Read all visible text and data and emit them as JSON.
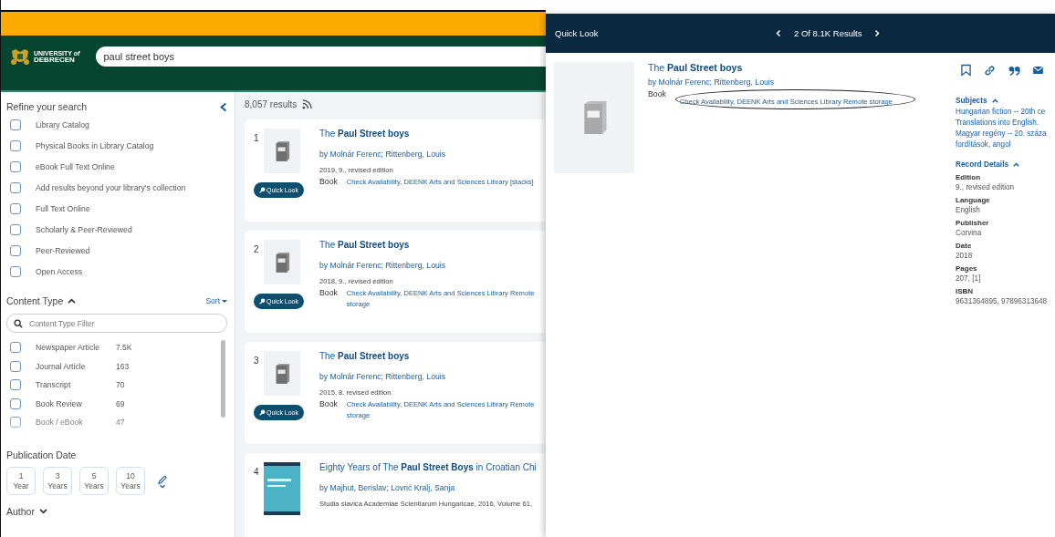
{
  "logo": {
    "line1": "UNIVERSITY *of*",
    "line2": "DEBRECEN"
  },
  "search": {
    "value": "paul street boys"
  },
  "sidebar": {
    "title": "Refine your search",
    "filters": [
      {
        "label": "Library Catalog",
        "checked": false
      },
      {
        "label": "Physical Books in Library Catalog",
        "checked": false
      },
      {
        "label": "eBook Full Text Online",
        "checked": false
      },
      {
        "label": "Add results beyond your library's collection",
        "checked": false
      },
      {
        "label": "Full Text Online",
        "checked": false
      },
      {
        "label": "Scholarly & Peer-Reviewed",
        "checked": false
      },
      {
        "label": "Peer-Reviewed",
        "checked": false
      },
      {
        "label": "Open Access",
        "checked": false
      }
    ],
    "content_type": {
      "title": "Content Type",
      "sort": "Sort",
      "filter_placeholder": "Content Type Filter",
      "expanded": true,
      "items": [
        {
          "label": "Newspaper Article",
          "count": "7.5K",
          "checked": false
        },
        {
          "label": "Journal Article",
          "count": "163",
          "checked": false
        },
        {
          "label": "Transcript",
          "count": "70",
          "checked": false
        },
        {
          "label": "Book Review",
          "count": "69",
          "checked": false
        },
        {
          "label": "Book / eBook",
          "count": "47",
          "checked": false
        }
      ]
    },
    "publication_date": {
      "title": "Publication Date",
      "ranges": [
        {
          "value": "1",
          "unit": "Year"
        },
        {
          "value": "3",
          "unit": "Years"
        },
        {
          "value": "5",
          "unit": "Years"
        },
        {
          "value": "10",
          "unit": "Years"
        }
      ]
    },
    "author": {
      "title": "Author",
      "expanded": false
    }
  },
  "results": {
    "count": "8,057 results",
    "items": [
      {
        "number": "1",
        "title": "The **Paul Street boys**",
        "authors": "by Molnár Ferenc; Rittenberg, Louis",
        "edition": "2019, 9., revised edition",
        "type": "Book",
        "availability": "Check Availability, DEENK Arts and Sciences Library [stacks]",
        "kind": "book",
        "quick_look": "Quick Look"
      },
      {
        "number": "2",
        "title": "The **Paul Street boys**",
        "authors": "by Molnár Ferenc; Rittenberg, Louis",
        "edition": "2018, 9., revised edition",
        "type": "Book",
        "availability": "Check Availability, DEENK Arts and Sciences Library Remote storage",
        "kind": "book",
        "quick_look": "Quick Look"
      },
      {
        "number": "3",
        "title": "The **Paul Street boys**",
        "authors": "by Molnár Ferenc; Rittenberg, Louis",
        "edition": "2015, 8. revised edition",
        "type": "Book",
        "availability": "Check Availability, DEENK Arts and Sciences Library Remote storage",
        "kind": "book",
        "quick_look": "Quick Look"
      },
      {
        "number": "4",
        "title": "Eighty Years of The **Paul Street Boys** in Croatian Chi",
        "authors": "by Majhut, Berislav; Lovrić Kralj, Sanja",
        "edition": "Studia slavica Academiae Scientiarum Hungaricae, 2016, Volume 61,",
        "kind": "article"
      }
    ]
  },
  "quick_look": {
    "title": "Quick Look",
    "position": "2 Of 8.1K Results",
    "record": {
      "title": "The **Paul Street boys**",
      "authors": "by Molnár Ferenc; Rittenberg, Louis",
      "type": "Book",
      "availability": "Check Availability, DEENK Arts and Sciences Library Remote storage"
    },
    "subjects": {
      "title": "Subjects",
      "expanded": true,
      "items": [
        "Hungarian fiction -- 20th ce",
        "Translations into English.",
        "Magyar regény -- 20. száza",
        "fordítások, angol"
      ]
    },
    "details": {
      "title": "Record Details",
      "expanded": true,
      "fields": [
        {
          "label": "Edition",
          "value": "9., revised edition"
        },
        {
          "label": "Language",
          "value": "English"
        },
        {
          "label": "Publisher",
          "value": "Corvina"
        },
        {
          "label": "Date",
          "value": "2018"
        },
        {
          "label": "Pages",
          "value": "207, [1]"
        },
        {
          "label": "ISBN",
          "value": "9631364895, 97896313648"
        }
      ]
    }
  }
}
